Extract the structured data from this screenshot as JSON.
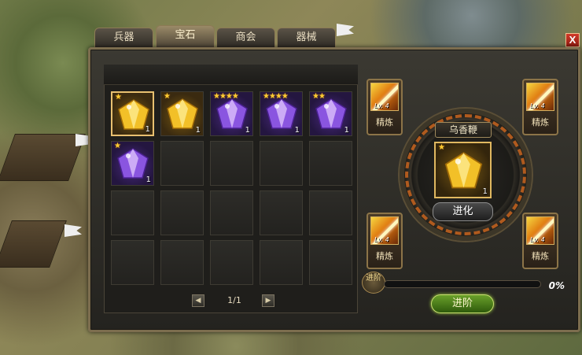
{
  "tabs": [
    {
      "label": "兵器"
    },
    {
      "label": "宝石"
    },
    {
      "label": "商会"
    },
    {
      "label": "器械"
    }
  ],
  "active_tab": "宝石",
  "close_label": "X",
  "inventory": {
    "slots": [
      {
        "gem": "gold-gem",
        "stars": "★",
        "qty": "1",
        "selected": true
      },
      {
        "gem": "gold-gem",
        "stars": "★",
        "qty": "1"
      },
      {
        "gem": "purple-gem",
        "stars": "★★★★",
        "qty": "1"
      },
      {
        "gem": "purple-gem",
        "stars": "★★★★",
        "qty": "1"
      },
      {
        "gem": "purple-gem",
        "stars": "★★",
        "qty": "1"
      },
      {
        "gem": "purple-gem",
        "stars": "★",
        "qty": "1"
      }
    ],
    "total_slots": 20,
    "page": "1/1"
  },
  "skills": [
    {
      "level": "Lv. 4",
      "label": "精炼"
    },
    {
      "level": "Lv. 4",
      "label": "精炼"
    },
    {
      "level": "Lv. 4",
      "label": "精炼"
    },
    {
      "level": "Lv. 4",
      "label": "精炼"
    }
  ],
  "center": {
    "name": "乌香鞭",
    "gem": "gold-gem",
    "stars": "★",
    "qty": "1",
    "evolve_label": "进化"
  },
  "progress": {
    "label": "进阶",
    "percent_text": "0%",
    "value": 0
  },
  "advance_label": "进阶",
  "colors": {
    "gold_gem": "#f2c028",
    "purple_gem": "#8a55e0",
    "accent": "#c8641e"
  }
}
